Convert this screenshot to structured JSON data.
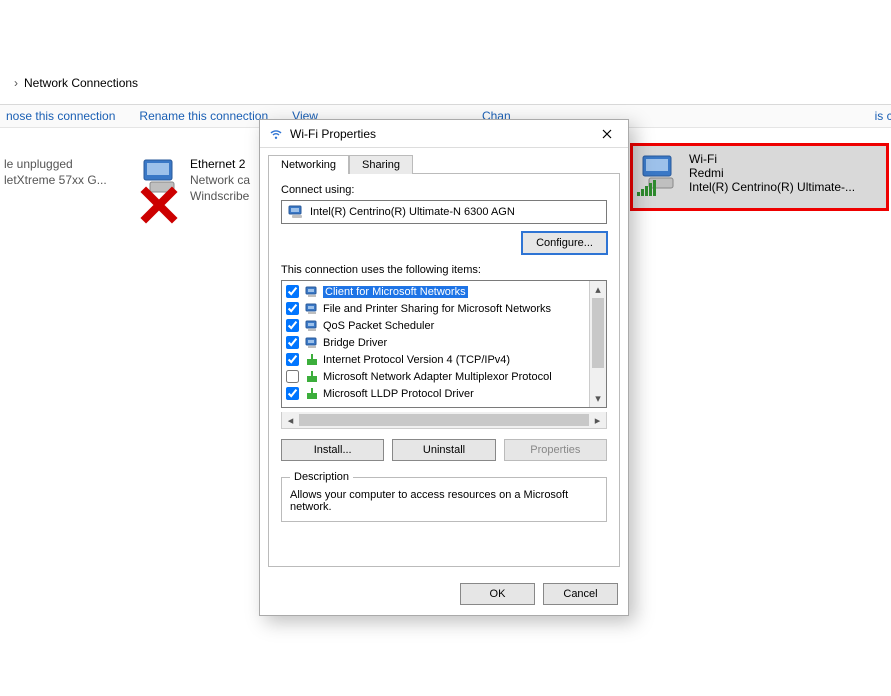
{
  "breadcrumb": {
    "label": "Network Connections"
  },
  "toolbar": {
    "diagnose": "nose this connection",
    "rename": "Rename this connection",
    "view_status_partial": "View",
    "change_partial": "Chan",
    "change_rest": "is connection"
  },
  "connections": {
    "partial": {
      "line2": "le unplugged",
      "line3": "letXtreme 57xx G..."
    },
    "ethernet": {
      "name": "Ethernet 2",
      "line2": "Network ca",
      "line3": "Windscribe"
    },
    "wifi": {
      "name": "Wi-Fi",
      "line2": "Redmi",
      "line3": "Intel(R) Centrino(R) Ultimate-..."
    }
  },
  "dialog": {
    "title": "Wi-Fi Properties",
    "tabs": {
      "networking": "Networking",
      "sharing": "Sharing"
    },
    "connect_using_label": "Connect using:",
    "adapter": "Intel(R) Centrino(R) Ultimate-N 6300 AGN",
    "configure_btn": "Configure...",
    "items_label": "This connection uses the following items:",
    "items": [
      {
        "checked": true,
        "kind": "client",
        "label": "Client for Microsoft Networks",
        "selected": true
      },
      {
        "checked": true,
        "kind": "client",
        "label": "File and Printer Sharing for Microsoft Networks"
      },
      {
        "checked": true,
        "kind": "client",
        "label": "QoS Packet Scheduler"
      },
      {
        "checked": true,
        "kind": "client",
        "label": "Bridge Driver"
      },
      {
        "checked": true,
        "kind": "proto",
        "label": "Internet Protocol Version 4 (TCP/IPv4)"
      },
      {
        "checked": false,
        "kind": "proto",
        "label": "Microsoft Network Adapter Multiplexor Protocol"
      },
      {
        "checked": true,
        "kind": "proto",
        "label": "Microsoft LLDP Protocol Driver"
      }
    ],
    "install_btn": "Install...",
    "uninstall_btn": "Uninstall",
    "properties_btn": "Properties",
    "desc_legend": "Description",
    "desc_text": "Allows your computer to access resources on a Microsoft network.",
    "ok_btn": "OK",
    "cancel_btn": "Cancel"
  }
}
